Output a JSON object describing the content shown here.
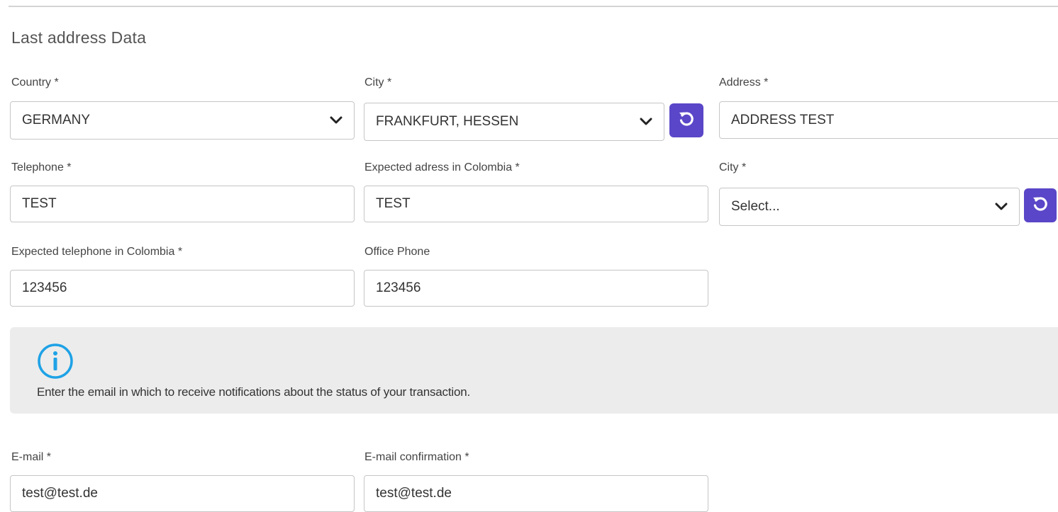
{
  "section": {
    "title": "Last address Data"
  },
  "fields": {
    "country": {
      "label": "Country *",
      "value": "GERMANY"
    },
    "city_last": {
      "label": "City *",
      "value": "FRANKFURT, HESSEN"
    },
    "address": {
      "label": "Address *",
      "value": "ADDRESS TEST"
    },
    "telephone": {
      "label": "Telephone *",
      "value": "TEST"
    },
    "expected_address": {
      "label": "Expected adress in Colombia *",
      "value": "TEST"
    },
    "city_colombia": {
      "label": "City *",
      "value": "Select..."
    },
    "expected_telephone": {
      "label": "Expected telephone in Colombia *",
      "value": "123456"
    },
    "office_phone": {
      "label": "Office Phone",
      "value": "123456"
    },
    "email": {
      "label": "E-mail *",
      "value": "test@test.de"
    },
    "email_confirmation": {
      "label": "E-mail confirmation *",
      "value": "test@test.de"
    }
  },
  "info": {
    "icon": "info-circle-icon",
    "text": "Enter the email in which to receive notifications about the status of your transaction."
  },
  "icons": {
    "dropdown": "chevron-down-icon",
    "refresh": "refresh-icon"
  },
  "colors": {
    "accent": "#5a46c8",
    "info_icon": "#1ea2e6",
    "info_background": "#ececec",
    "field_border": "#c6c6c6"
  }
}
